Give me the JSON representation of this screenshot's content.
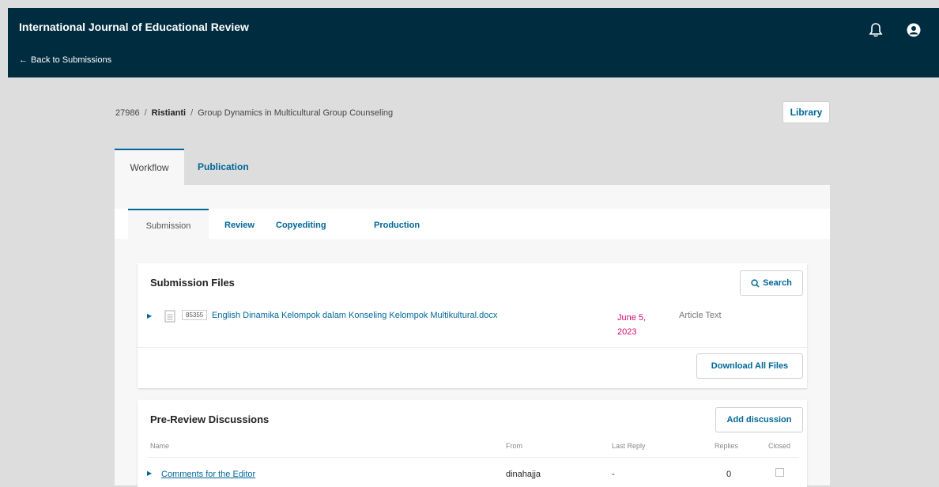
{
  "header": {
    "journal_title": "International Journal of Educational Review",
    "back_link": "Back to Submissions",
    "bell_icon": "bell-icon",
    "user_icon": "user-icon"
  },
  "breadcrumb": {
    "id": "27986",
    "author": "Ristianti",
    "title": "Group Dynamics in Multicultural Group Counseling"
  },
  "library_button": "Library",
  "outer_tabs": [
    {
      "label": "Workflow",
      "active": true
    },
    {
      "label": "Publication",
      "active": false
    }
  ],
  "inner_tabs": [
    {
      "label": "Submission",
      "active": true
    },
    {
      "label": "Review",
      "active": false
    },
    {
      "label": "Copyediting",
      "active": false
    },
    {
      "label": "Production",
      "active": false
    }
  ],
  "submission_files": {
    "title": "Submission Files",
    "search_label": "Search",
    "download_all_label": "Download All Files",
    "files": [
      {
        "id": "85355",
        "name": "English Dinamika Kelompok dalam Konseling Kelompok Multikultural.docx",
        "date": "June 5, 2023",
        "type": "Article Text"
      }
    ]
  },
  "discussions": {
    "title": "Pre-Review Discussions",
    "add_label": "Add discussion",
    "columns": [
      "Name",
      "From",
      "Last Reply",
      "Replies",
      "Closed"
    ],
    "rows": [
      {
        "name": "Comments for the Editor",
        "from": "dinahajja",
        "last_reply": "-",
        "replies": "0",
        "closed": false
      }
    ]
  },
  "colors": {
    "header_bg": "#002c40",
    "accent": "#006798",
    "date": "#d00a6c",
    "page_bg": "#dddddd"
  }
}
